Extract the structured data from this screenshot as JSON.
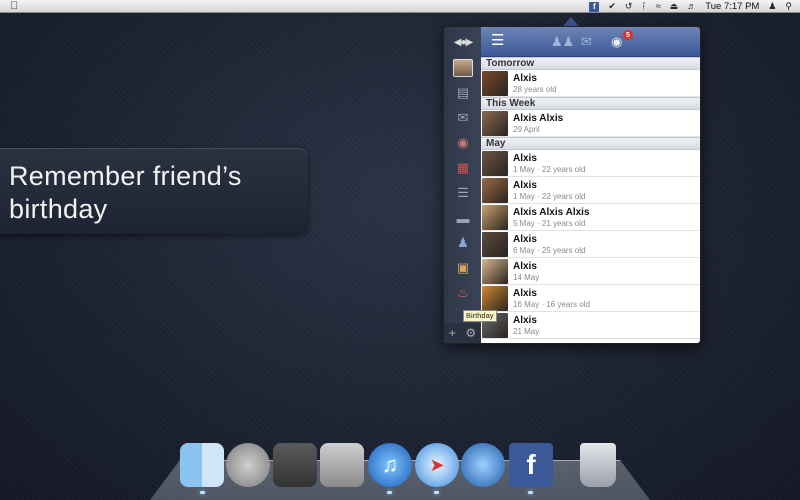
{
  "menubar": {
    "apple_icon": "apple-logo",
    "status_icons": [
      "facebook-icon",
      "check-circle-icon",
      "time-machine-icon",
      "bluetooth-icon",
      "wifi-icon",
      "eject-icon",
      "volume-icon"
    ],
    "clock": "Tue 7:17 PM",
    "user_icon": "user-icon",
    "search_icon": "spotlight-icon"
  },
  "caption": {
    "line1": "Remember friend’s",
    "line2": "birthday"
  },
  "panel": {
    "topbar": {
      "menu_icon": "menu-icon",
      "friends_icon": "friends-icon",
      "messages_icon": "messages-icon",
      "notifications_icon": "globe-icon",
      "notifications_count": "5"
    },
    "sidebar": {
      "nav_icon": "nav-arrows-icon",
      "items": [
        "profile-avatar",
        "news-feed-icon",
        "messages-icon",
        "places-icon",
        "calendar-icon",
        "events-icon",
        "notes-icon",
        "friends-icon",
        "photos-icon",
        "birthday-cake-icon"
      ],
      "bottom": [
        "add-icon",
        "settings-icon"
      ]
    },
    "tooltip": "Birthday",
    "sections": [
      {
        "label": "Tomorrow",
        "rows": [
          {
            "name": "Alxis",
            "sub": "28 years old",
            "color": "#7a4a2a"
          }
        ]
      },
      {
        "label": "This Week",
        "rows": [
          {
            "name": "Alxis  Alxis",
            "sub": "29 April",
            "color": "#8a6a50"
          }
        ]
      },
      {
        "label": "May",
        "rows": [
          {
            "name": "Alxis",
            "sub": "1 May · 22 years old",
            "color": "#6a5546"
          },
          {
            "name": "Alxis",
            "sub": "1 May · 22 years old",
            "color": "#9a6a48"
          },
          {
            "name": "Alxis Alxis Alxis",
            "sub": "5 May · 21 years old",
            "color": "#c9a26e"
          },
          {
            "name": "Alxis",
            "sub": "6 May · 25 years old",
            "color": "#5a4a40"
          },
          {
            "name": "Alxis",
            "sub": "14 May",
            "color": "#d8b890"
          },
          {
            "name": "Alxis",
            "sub": "16 May · 16 years old",
            "color": "#d08a30"
          },
          {
            "name": "Alxis",
            "sub": "21 May",
            "color": "#6a6a6a"
          }
        ]
      }
    ]
  },
  "dock": {
    "apps": [
      "finder-icon",
      "launchpad-icon",
      "photo-browser-icon",
      "system-preferences-icon",
      "itunes-icon",
      "safari-icon",
      "quicktime-icon",
      "facebook-app-icon",
      "trash-icon"
    ]
  }
}
